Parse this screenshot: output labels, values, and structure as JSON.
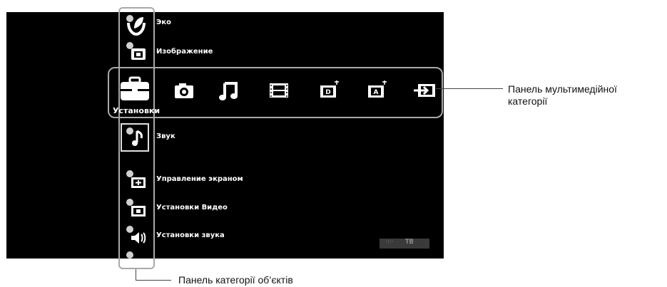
{
  "item_categories": [
    {
      "label": "Эко",
      "icon": "eco-icon"
    },
    {
      "label": "Изображение",
      "icon": "picture-icon"
    },
    {
      "label": "Звук",
      "icon": "sound-icon"
    },
    {
      "label": "Управление экраном",
      "icon": "screen-control-icon"
    },
    {
      "label": "Установки Видео",
      "icon": "video-settings-icon"
    },
    {
      "label": "Установки звука",
      "icon": "sound-settings-icon"
    }
  ],
  "media_bar": {
    "selected_label": "Установки",
    "icons": [
      "settings-toolbox-icon",
      "photo-icon",
      "music-icon",
      "video-icon",
      "tv-digital-icon",
      "tv-analog-icon",
      "external-input-icon"
    ]
  },
  "status": {
    "tv_label": "ТВ",
    "dots": "·:··"
  },
  "callouts": {
    "media_line1": "Панель мультимедійної",
    "media_line2": "категорії",
    "items": "Панель категорії об’єктів"
  },
  "colors": {
    "screen_bg": "#000000",
    "text": "#ffffff",
    "frame": "#a9a9a9"
  }
}
